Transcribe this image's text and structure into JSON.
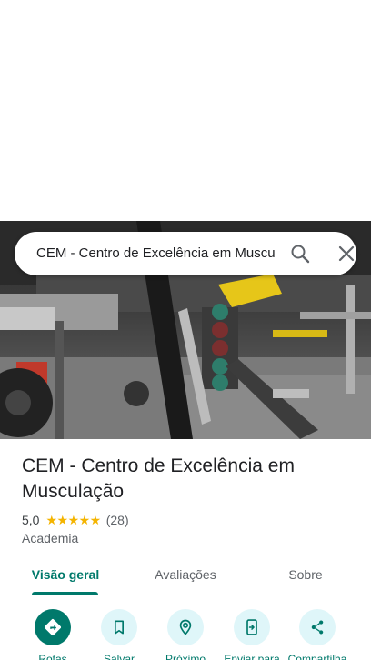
{
  "search": {
    "query": "CEM - Centro de Excelência em Musculação"
  },
  "place": {
    "name": "CEM - Centro de Excelência em Musculação",
    "rating": "5,0",
    "stars": "★★★★★",
    "review_count": "(28)",
    "category": "Academia"
  },
  "tabs": [
    {
      "label": "Visão geral",
      "active": true
    },
    {
      "label": "Avaliações",
      "active": false
    },
    {
      "label": "Sobre",
      "active": false
    }
  ],
  "actions": [
    {
      "label": "Rotas",
      "icon": "directions-icon"
    },
    {
      "label": "Salvar",
      "icon": "bookmark-icon"
    },
    {
      "label": "Próximo",
      "icon": "nearby-icon"
    },
    {
      "label": "Enviar para",
      "icon": "send-to-phone-icon"
    },
    {
      "label": "Compartilha",
      "icon": "share-icon"
    }
  ],
  "colors": {
    "accent": "#00796b",
    "action_bg": "#dff6f9",
    "star": "#f4b400"
  }
}
